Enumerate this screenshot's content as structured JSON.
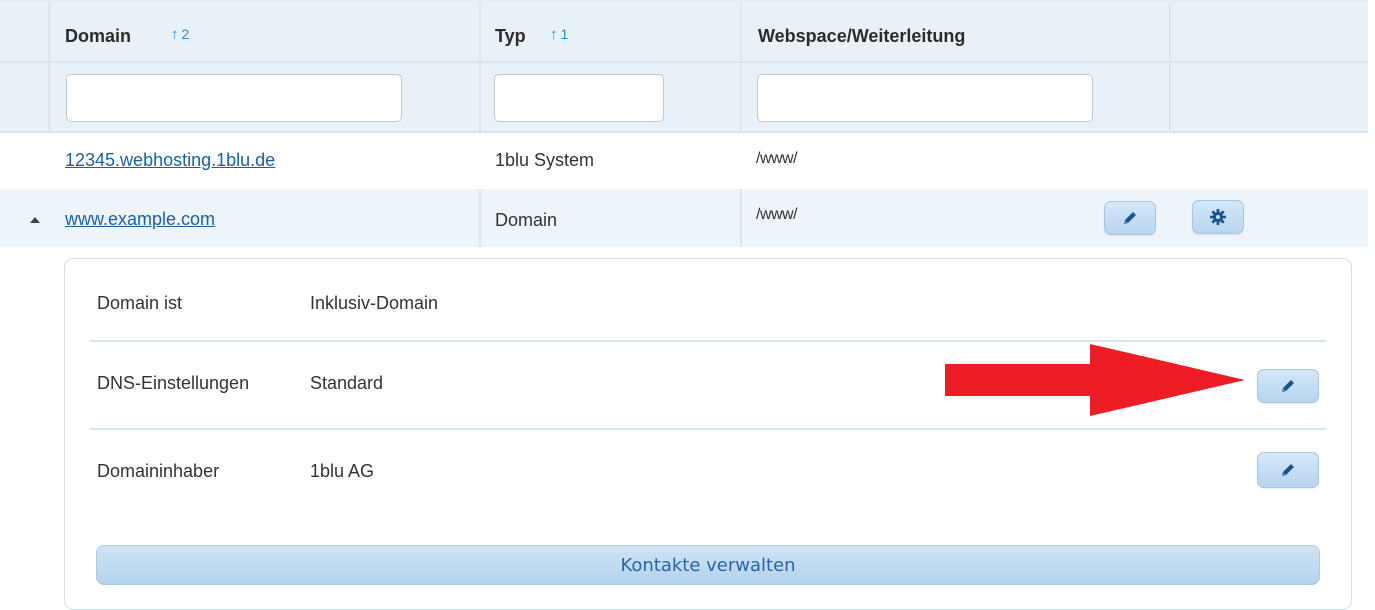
{
  "table": {
    "columns": [
      {
        "title": "Domain",
        "sort_order": "2"
      },
      {
        "title": "Typ",
        "sort_order": "1"
      },
      {
        "title": "Webspace/Weiterleitung"
      }
    ],
    "filters": {
      "domain": "",
      "typ": "",
      "webspace": ""
    },
    "rows": [
      {
        "domain": "12345.webhosting.1blu.de",
        "typ": "1blu System",
        "webspace": "/www/"
      },
      {
        "domain": "www.example.com",
        "typ": "Domain",
        "webspace": "/www/",
        "expanded": true
      }
    ]
  },
  "details": {
    "items": [
      {
        "label": "Domain ist",
        "value": "Inklusiv-Domain"
      },
      {
        "label": "DNS-Einstellungen",
        "value": "Standard"
      },
      {
        "label": "Domaininhaber",
        "value": "1blu AG"
      }
    ],
    "contacts_button": "Kontakte verwalten"
  },
  "icons": {
    "sort": "arrow-up-icon",
    "edit": "pencil-icon",
    "settings": "gear-icon",
    "expand": "caret-up-icon",
    "annotation": "red-arrow-icon"
  },
  "colors": {
    "header_bg": "#e8f1f8",
    "link": "#1c5fa8",
    "sort_indicator": "#2d8bd4",
    "button_text": "#2a63a8",
    "annotation_arrow": "#ee1c25"
  }
}
